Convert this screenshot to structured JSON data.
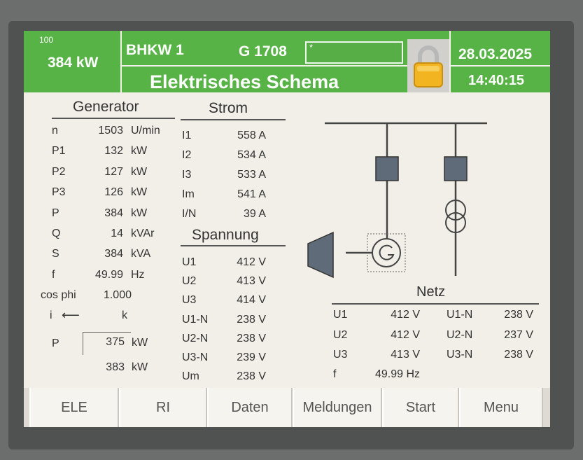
{
  "header": {
    "power_small": "100",
    "power_kw": "384 kW",
    "unit_name": "BHKW   1",
    "unit_code": "G 1708",
    "input_value": "*",
    "title": "Elektrisches Schema",
    "date": "28.03.2025",
    "time": "14:40:15",
    "lock_icon": "padlock-icon"
  },
  "generator": {
    "title": "Generator",
    "rows": [
      {
        "label": "n",
        "value": "1503",
        "unit": "U/min"
      },
      {
        "label": "P1",
        "value": "132",
        "unit": "kW"
      },
      {
        "label": "P2",
        "value": "127",
        "unit": "kW"
      },
      {
        "label": "P3",
        "value": "126",
        "unit": "kW"
      },
      {
        "label": "P",
        "value": "384",
        "unit": "kW"
      },
      {
        "label": "Q",
        "value": "14",
        "unit": "kVAr"
      },
      {
        "label": "S",
        "value": "384",
        "unit": "kVA"
      },
      {
        "label": "f",
        "value": "49.99",
        "unit": "Hz"
      },
      {
        "label": "cos phi",
        "value": "1.000",
        "unit": ""
      }
    ],
    "i_label": "i",
    "i_unit": "k",
    "setpoint_label": "P",
    "setpoint_value": "375",
    "setpoint_unit": "kW",
    "actual_value": "383",
    "actual_unit": "kW"
  },
  "strom": {
    "title": "Strom",
    "rows": [
      {
        "label": "I1",
        "value": "558 A"
      },
      {
        "label": "I2",
        "value": "534 A"
      },
      {
        "label": "I3",
        "value": "533 A"
      },
      {
        "label": "Im",
        "value": "541 A"
      },
      {
        "label": "I/N",
        "value": "39 A"
      }
    ]
  },
  "spannung": {
    "title": "Spannung",
    "rows": [
      {
        "label": "U1",
        "value": "412 V"
      },
      {
        "label": "U2",
        "value": "413 V"
      },
      {
        "label": "U3",
        "value": "414 V"
      },
      {
        "label": "U1-N",
        "value": "238 V"
      },
      {
        "label": "U2-N",
        "value": "238 V"
      },
      {
        "label": "U3-N",
        "value": "239 V"
      },
      {
        "label": "Um",
        "value": "238 V"
      }
    ]
  },
  "netz": {
    "title": "Netz",
    "rows": [
      {
        "l1": "U1",
        "v1": "412 V",
        "l2": "U1-N",
        "v2": "238 V"
      },
      {
        "l1": "U2",
        "v1": "412 V",
        "l2": "U2-N",
        "v2": "237 V"
      },
      {
        "l1": "U3",
        "v1": "413 V",
        "l2": "U3-N",
        "v2": "238 V"
      }
    ],
    "f_label": "f",
    "f_value": "49.99 Hz"
  },
  "buttons": [
    "ELE",
    "RI",
    "Daten",
    "Meldungen",
    "Start",
    "Menu"
  ],
  "colors": {
    "header_green": "#58b346",
    "screen_bg": "#f2efe8",
    "switch_fill": "#5f6b78",
    "lock_gold": "#f2b420"
  }
}
